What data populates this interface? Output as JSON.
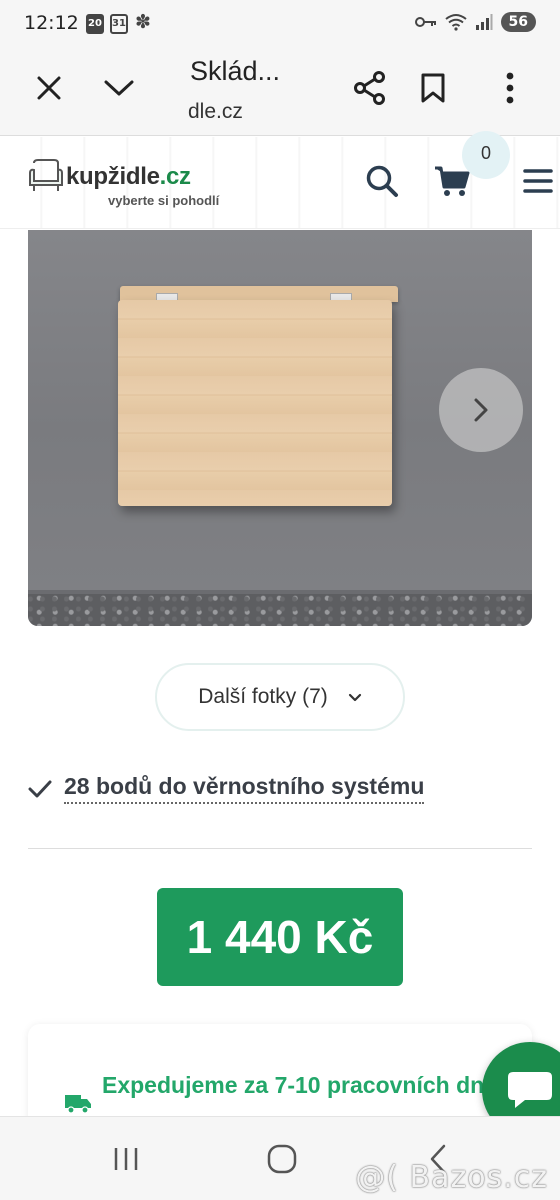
{
  "status_bar": {
    "time": "12:12",
    "badge_1": "20",
    "badge_2": "31",
    "battery": "56"
  },
  "browser": {
    "tab_title": "Sklád...",
    "url": "dle.cz",
    "icons": [
      "close-icon",
      "chevron-down-icon",
      "share-icon",
      "bookmark-icon",
      "more-vert-icon"
    ]
  },
  "site_header": {
    "logo_brand": "kupžidle",
    "logo_tld": ".cz",
    "logo_tagline": "vyberte si pohodlí",
    "cart_count": "0",
    "icons": [
      "search-icon",
      "cart-icon",
      "menu-icon"
    ]
  },
  "gallery": {
    "next_icon": "chevron-right-icon"
  },
  "more_photos": {
    "label": "Další fotky (7)"
  },
  "loyalty": {
    "text": "28 bodů do věrnostního systému"
  },
  "price": {
    "label": "1 440 Kč"
  },
  "delivery": {
    "text": "Expedujeme za 7-10 pracovních dnů"
  },
  "watermark": {
    "text": "@( Bazos.cz"
  },
  "colors": {
    "brand_green": "#1e9a5c",
    "delivery_green": "#23a76a",
    "chat_green": "#1b8c4c"
  }
}
